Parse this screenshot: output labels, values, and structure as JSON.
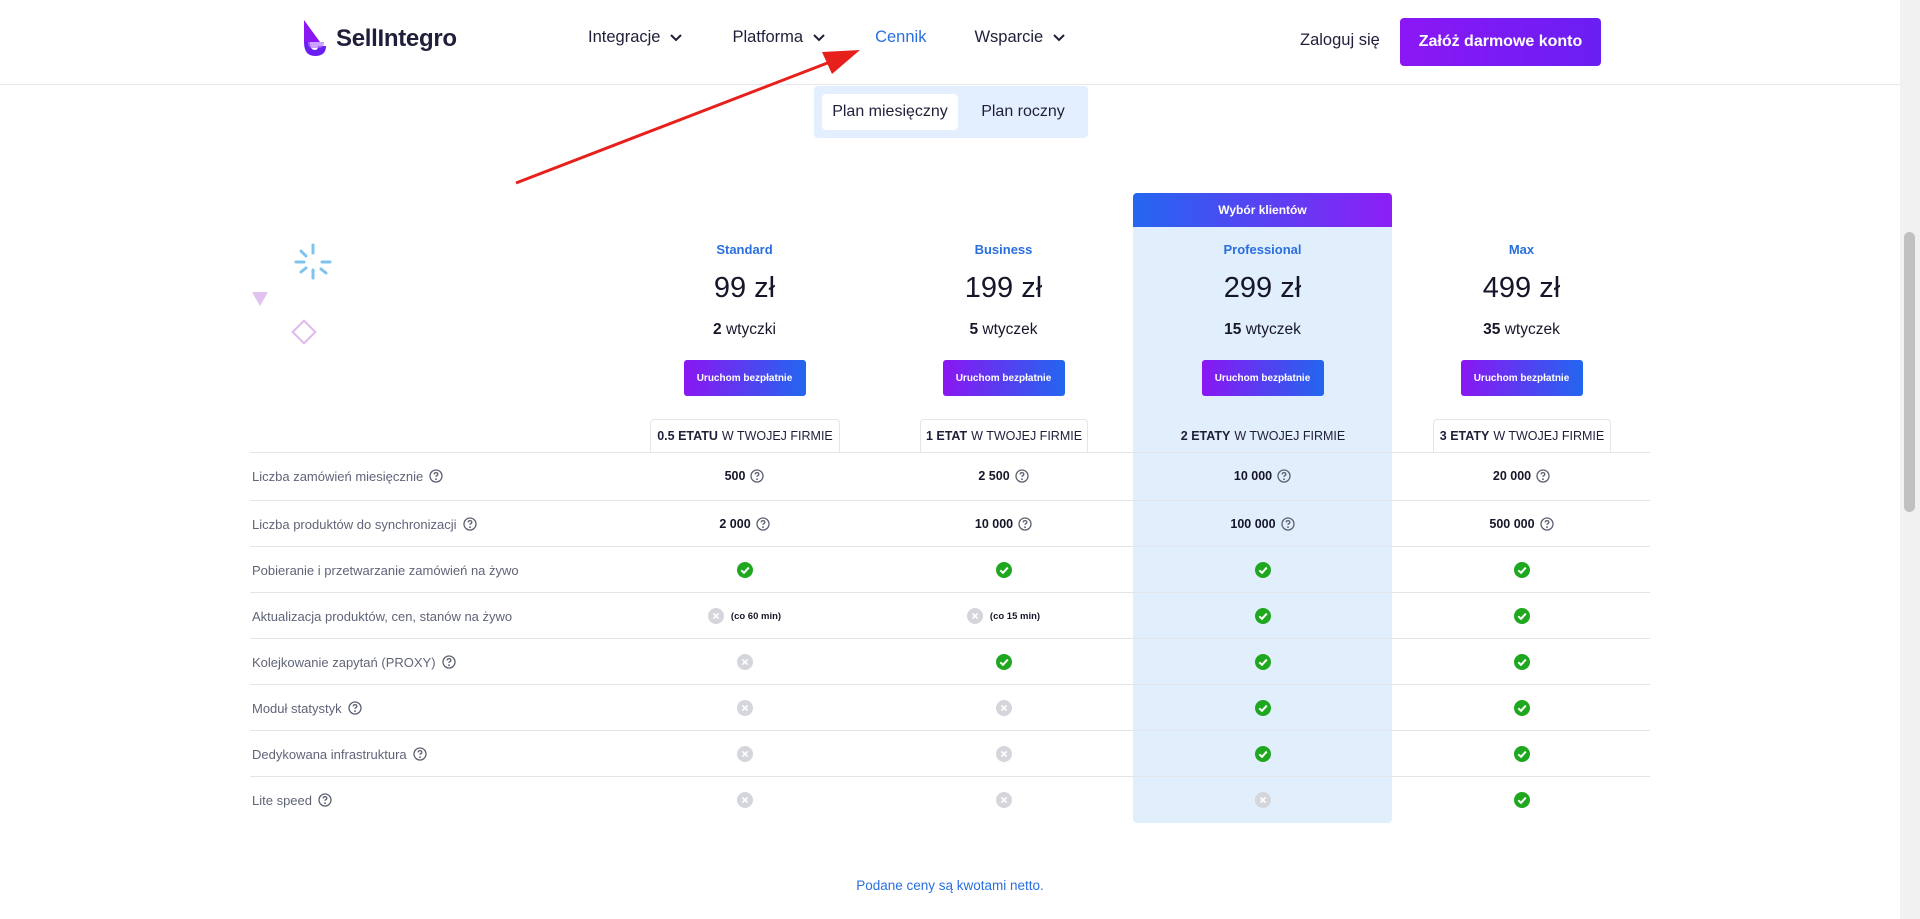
{
  "header": {
    "logo_text": "SellIntegro",
    "nav": [
      {
        "label": "Integracje",
        "dropdown": true,
        "active": false
      },
      {
        "label": "Platforma",
        "dropdown": true,
        "active": false
      },
      {
        "label": "Cennik",
        "dropdown": false,
        "active": true
      },
      {
        "label": "Wsparcie",
        "dropdown": true,
        "active": false
      }
    ],
    "login_label": "Zaloguj się",
    "cta_label": "Załóż darmowe konto"
  },
  "billing_toggle": {
    "options": [
      "Plan miesięczny",
      "Plan roczny"
    ],
    "selected": "Plan miesięczny"
  },
  "highlight_badge": "Wybór klientów",
  "plans": [
    {
      "name": "Standard",
      "price": "99 zł",
      "plugins_count": "2",
      "plugins_word": "wtyczki",
      "button": "Uruchom bezpłatnie",
      "etat_bold": "0.5 ETATU",
      "etat_rest": "W TWOJEJ FIRMIE"
    },
    {
      "name": "Business",
      "price": "199 zł",
      "plugins_count": "5",
      "plugins_word": "wtyczek",
      "button": "Uruchom bezpłatnie",
      "etat_bold": "1 ETAT",
      "etat_rest": "W TWOJEJ FIRMIE"
    },
    {
      "name": "Professional",
      "price": "299 zł",
      "plugins_count": "15",
      "plugins_word": "wtyczek",
      "button": "Uruchom bezpłatnie",
      "etat_bold": "2 ETATY",
      "etat_rest": "W TWOJEJ FIRMIE"
    },
    {
      "name": "Max",
      "price": "499 zł",
      "plugins_count": "35",
      "plugins_word": "wtyczek",
      "button": "Uruchom bezpłatnie",
      "etat_bold": "3 ETATY",
      "etat_rest": "W TWOJEJ FIRMIE"
    }
  ],
  "features": [
    {
      "label": "Liczba zamówień miesięcznie",
      "help": true,
      "cells": [
        {
          "t": "text",
          "v": "500",
          "help": true
        },
        {
          "t": "text",
          "v": "2 500",
          "help": true
        },
        {
          "t": "text",
          "v": "10 000",
          "help": true
        },
        {
          "t": "text",
          "v": "20 000",
          "help": true
        }
      ]
    },
    {
      "label": "Liczba produktów do synchronizacji",
      "help": true,
      "cells": [
        {
          "t": "text",
          "v": "2 000",
          "help": true
        },
        {
          "t": "text",
          "v": "10 000",
          "help": true
        },
        {
          "t": "text",
          "v": "100 000",
          "help": true
        },
        {
          "t": "text",
          "v": "500 000",
          "help": true
        }
      ]
    },
    {
      "label": "Pobieranie i przetwarzanie zamówień na żywo",
      "help": false,
      "cells": [
        {
          "t": "yes"
        },
        {
          "t": "yes"
        },
        {
          "t": "yes"
        },
        {
          "t": "yes"
        }
      ]
    },
    {
      "label": "Aktualizacja produktów, cen, stanów na żywo",
      "help": false,
      "cells": [
        {
          "t": "no",
          "note": "(co 60 min)"
        },
        {
          "t": "no",
          "note": "(co 15 min)"
        },
        {
          "t": "yes"
        },
        {
          "t": "yes"
        }
      ]
    },
    {
      "label": "Kolejkowanie zapytań (PROXY)",
      "help": true,
      "cells": [
        {
          "t": "no"
        },
        {
          "t": "yes"
        },
        {
          "t": "yes"
        },
        {
          "t": "yes"
        }
      ]
    },
    {
      "label": "Moduł statystyk",
      "help": true,
      "cells": [
        {
          "t": "no"
        },
        {
          "t": "no"
        },
        {
          "t": "yes"
        },
        {
          "t": "yes"
        }
      ]
    },
    {
      "label": "Dedykowana infrastruktura",
      "help": true,
      "cells": [
        {
          "t": "no"
        },
        {
          "t": "no"
        },
        {
          "t": "yes"
        },
        {
          "t": "yes"
        }
      ]
    },
    {
      "label": "Lite speed",
      "help": true,
      "cells": [
        {
          "t": "no"
        },
        {
          "t": "no"
        },
        {
          "t": "no"
        },
        {
          "t": "yes"
        }
      ]
    }
  ],
  "footnote": "Podane ceny są kwotami netto.",
  "colors": {
    "accent": "#2a6fdf",
    "cta": "#8b17f5",
    "check": "#1fa81f",
    "cross": "#d4d6dc",
    "highlight": "#e1eefc"
  }
}
